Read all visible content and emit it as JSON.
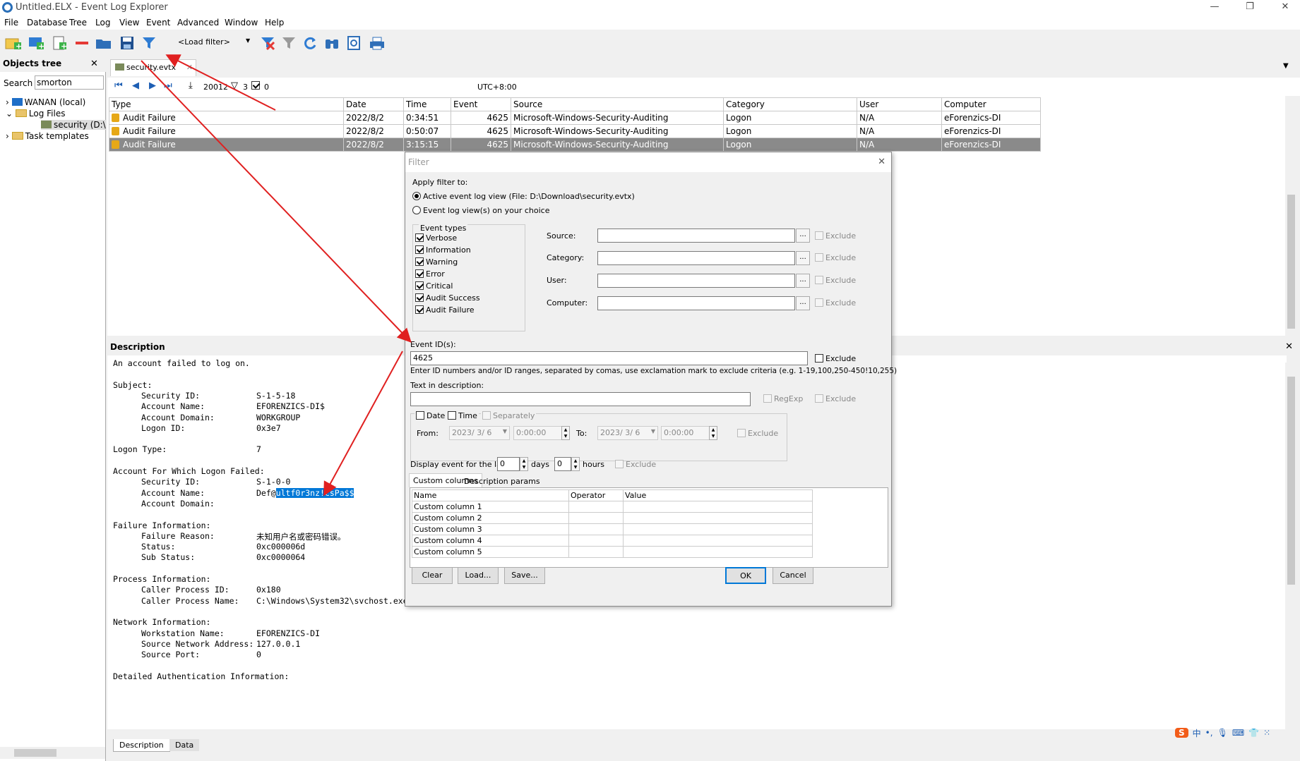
{
  "window": {
    "title": "Untitled.ELX - Event Log Explorer"
  },
  "menu": [
    "File",
    "Database",
    "Tree",
    "Log",
    "View",
    "Event",
    "Advanced",
    "Window",
    "Help"
  ],
  "toolbar": {
    "load_filter": "<Load filter>"
  },
  "objects_tree": {
    "title": "Objects tree",
    "search_label": "Search",
    "search_value": "smorton",
    "items": [
      {
        "label": "WANAN (local)"
      },
      {
        "label": "Log Files"
      },
      {
        "label": "security (D:\\"
      },
      {
        "label": "Task templates"
      }
    ]
  },
  "tab": {
    "label": "security.evtx"
  },
  "nav": {
    "count": "20012",
    "filter_count": "3",
    "checked_count": "0",
    "timezone": "UTC+8:00"
  },
  "grid": {
    "columns": [
      "Type",
      "Date",
      "Time",
      "Event",
      "Source",
      "Category",
      "User",
      "Computer"
    ],
    "rows": [
      {
        "type": "Audit Failure",
        "date": "2022/8/2",
        "time": "0:34:51",
        "event": "4625",
        "source": "Microsoft-Windows-Security-Auditing",
        "category": "Logon",
        "user": "N/A",
        "computer": "eForenzics-DI"
      },
      {
        "type": "Audit Failure",
        "date": "2022/8/2",
        "time": "0:50:07",
        "event": "4625",
        "source": "Microsoft-Windows-Security-Auditing",
        "category": "Logon",
        "user": "N/A",
        "computer": "eForenzics-DI"
      },
      {
        "type": "Audit Failure",
        "date": "2022/8/2",
        "time": "3:15:15",
        "event": "4625",
        "source": "Microsoft-Windows-Security-Auditing",
        "category": "Logon",
        "user": "N/A",
        "computer": "eForenzics-DI"
      }
    ]
  },
  "description": {
    "title": "Description",
    "lines": [
      "An account failed to log on.",
      "",
      "Subject:",
      "\tSecurity ID:|S-1-5-18",
      "\tAccount Name:|EFORENZICS-DI$",
      "\tAccount Domain:|WORKGROUP",
      "\tLogon ID:|0x3e7",
      "",
      "Logon Type:|7",
      "",
      "Account For Which Logon Failed:",
      "\tSecurity ID:|S-1-0-0",
      "\tAccount Name:|Def@ultf0r3nz!csPa$$",
      "\tAccount Domain:|",
      "",
      "Failure Information:",
      "\tFailure Reason:|未知用户名或密码错误。",
      "\tStatus:|0xc000006d",
      "\tSub Status:|0xc0000064",
      "",
      "Process Information:",
      "\tCaller Process ID:|0x180",
      "\tCaller Process Name:|C:\\Windows\\System32\\svchost.exe",
      "",
      "Network Information:",
      "\tWorkstation Name:|EFORENZICS-DI",
      "\tSource Network Address:|127.0.0.1",
      "\tSource Port:|0",
      "",
      "Detailed Authentication Information:"
    ],
    "account_name_plain": "Def@",
    "account_name_selected": "ultf0r3nz!csPa$$",
    "tabs": [
      "Description",
      "Data"
    ]
  },
  "filter_dialog": {
    "title": "Filter",
    "apply_label": "Apply filter to:",
    "radio_active": "Active event log view (File: D:\\Download\\security.evtx)",
    "radio_choice": "Event log view(s) on your choice",
    "event_types_label": "Event types",
    "event_types": [
      "Verbose",
      "Information",
      "Warning",
      "Error",
      "Critical",
      "Audit Success",
      "Audit Failure"
    ],
    "source_label": "Source:",
    "category_label": "Category:",
    "user_label": "User:",
    "computer_label": "Computer:",
    "exclude": "Exclude",
    "event_ids_label": "Event ID(s):",
    "event_ids_value": "4625",
    "event_ids_hint": "Enter ID numbers and/or ID ranges, separated by comas, use exclamation mark to exclude criteria (e.g. 1-19,100,250-450!10,255)",
    "text_desc_label": "Text in description:",
    "regexp": "RegExp",
    "date_label": "Date",
    "time_label": "Time",
    "separately_label": "Separately",
    "from_label": "From:",
    "to_label": "To:",
    "from_date": "2023/ 3/ 6",
    "from_time": "0:00:00",
    "to_date": "2023/ 3/ 6",
    "to_time": "0:00:00",
    "display_last_label": "Display event for the last",
    "days_value": "0",
    "days_label": "days",
    "hours_value": "0",
    "hours_label": "hours",
    "tabs": [
      "Custom columns",
      "Description params"
    ],
    "columns": [
      "Name",
      "Operator",
      "Value"
    ],
    "custom_rows": [
      "Custom column 1",
      "Custom column 2",
      "Custom column 3",
      "Custom column 4",
      "Custom column 5"
    ],
    "buttons": {
      "clear": "Clear",
      "load": "Load...",
      "save": "Save...",
      "ok": "OK",
      "cancel": "Cancel"
    }
  },
  "colors": {
    "arrow": "#e02020",
    "selection": "#0078d7",
    "selected_row": "#8a8a8a"
  }
}
